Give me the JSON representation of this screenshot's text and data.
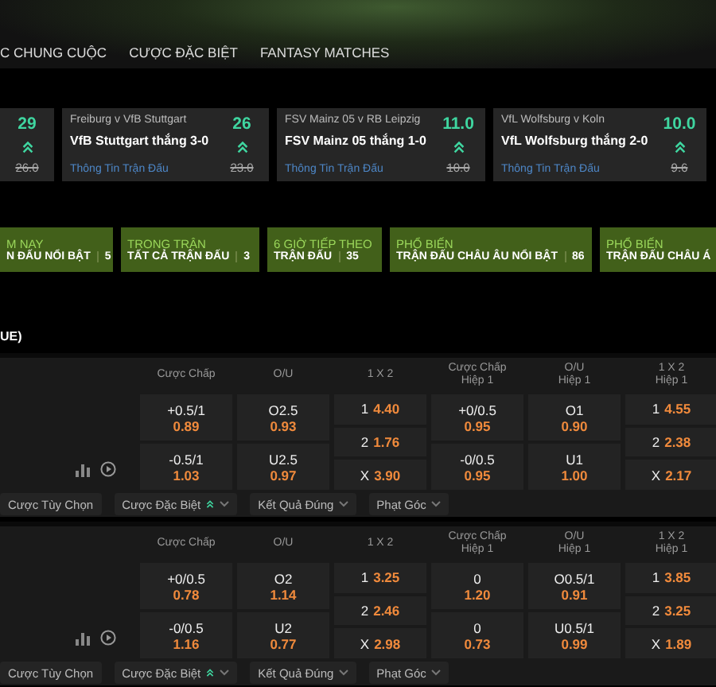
{
  "nav": {
    "tabs": [
      {
        "label": "C CHUNG CUỘC"
      },
      {
        "label": "CƯỢC ĐẶC BIỆT"
      },
      {
        "label": "FANTASY MATCHES"
      }
    ]
  },
  "featured_bets": [
    {
      "odds": "29",
      "old_odds": "26.0"
    },
    {
      "match": "Freiburg v VfB Stuttgart",
      "bet": "VfB Stuttgart thắng 3-0",
      "link": "Thông Tin Trận Đấu",
      "odds": "26",
      "old_odds": "23.0"
    },
    {
      "match": "FSV Mainz 05 v RB Leipzig",
      "bet": "FSV Mainz 05 thắng 1-0",
      "link": "Thông Tin Trận Đấu",
      "odds": "11.0",
      "old_odds": "10.0"
    },
    {
      "match": "VfL Wolfsburg v Koln",
      "bet": "VfL Wolfsburg thắng 2-0",
      "link": "Thông Tin Trận Đấu",
      "odds": "10.0",
      "old_odds": "9.6"
    }
  ],
  "categories": [
    {
      "title": "M NAY",
      "subtitle": "N ĐẤU NỔI BẬT",
      "count": "5"
    },
    {
      "title": "TRONG TRẬN",
      "subtitle": "TẤT CẢ TRẬN ĐẤU",
      "count": "3"
    },
    {
      "title": "6 GIỜ TIẾP THEO",
      "subtitle": "TRẬN ĐẤU",
      "count": "35"
    },
    {
      "title": "PHỔ BIẾN",
      "subtitle": "TRẬN ĐẤU CHÂU ÂU NỔI BẬT",
      "count": "86"
    },
    {
      "title": "PHỔ BIẾN",
      "subtitle": "TRẬN ĐẤU CHÂU Á"
    }
  ],
  "section_title": "UE)",
  "matches": [
    {
      "headers": [
        {
          "label": "Cược Chấp"
        },
        {
          "label": "O/U"
        },
        {
          "label": "1 X 2"
        },
        {
          "label": "Cược Chấp",
          "sub": "Hiệp 1"
        },
        {
          "label": "O/U",
          "sub": "Hiệp 1"
        },
        {
          "label": "1 X 2",
          "sub": "Hiệp 1"
        }
      ],
      "markets": [
        {
          "kind": "pair",
          "cells": [
            {
              "line": "+0.5/1",
              "odds": "0.89"
            },
            {
              "line": "-0.5/1",
              "odds": "1.03"
            }
          ]
        },
        {
          "kind": "pair",
          "cells": [
            {
              "line": "O2.5",
              "odds": "0.93"
            },
            {
              "line": "U2.5",
              "odds": "0.97"
            }
          ]
        },
        {
          "kind": "triple",
          "cells": [
            {
              "line": "1",
              "odds": "4.40"
            },
            {
              "line": "2",
              "odds": "1.76"
            },
            {
              "line": "X",
              "odds": "3.90"
            }
          ]
        },
        {
          "kind": "pair",
          "cells": [
            {
              "line": "+0/0.5",
              "odds": "0.95"
            },
            {
              "line": "-0/0.5",
              "odds": "0.95"
            }
          ]
        },
        {
          "kind": "pair",
          "cells": [
            {
              "line": "O1",
              "odds": "0.90"
            },
            {
              "line": "U1",
              "odds": "1.00"
            }
          ]
        },
        {
          "kind": "triple",
          "cells": [
            {
              "line": "1",
              "odds": "4.55"
            },
            {
              "line": "2",
              "odds": "2.38"
            },
            {
              "line": "X",
              "odds": "2.17"
            }
          ]
        }
      ],
      "options": [
        {
          "label": "Cược Tùy Chọn",
          "kind": "plain"
        },
        {
          "label": "Cược Đặc Biệt",
          "kind": "special"
        },
        {
          "label": "Kết Quả Đúng",
          "kind": "dropdown"
        },
        {
          "label": "Phạt Góc",
          "kind": "dropdown"
        }
      ]
    },
    {
      "headers": [
        {
          "label": "Cược Chấp"
        },
        {
          "label": "O/U"
        },
        {
          "label": "1 X 2"
        },
        {
          "label": "Cược Chấp",
          "sub": "Hiệp 1"
        },
        {
          "label": "O/U",
          "sub": "Hiệp 1"
        },
        {
          "label": "1 X 2",
          "sub": "Hiệp 1"
        }
      ],
      "markets": [
        {
          "kind": "pair",
          "cells": [
            {
              "line": "+0/0.5",
              "odds": "0.78"
            },
            {
              "line": "-0/0.5",
              "odds": "1.16"
            }
          ]
        },
        {
          "kind": "pair",
          "cells": [
            {
              "line": "O2",
              "odds": "1.14"
            },
            {
              "line": "U2",
              "odds": "0.77"
            }
          ]
        },
        {
          "kind": "triple",
          "cells": [
            {
              "line": "1",
              "odds": "3.25"
            },
            {
              "line": "2",
              "odds": "2.46"
            },
            {
              "line": "X",
              "odds": "2.98"
            }
          ]
        },
        {
          "kind": "pair",
          "cells": [
            {
              "line": "0",
              "odds": "1.20"
            },
            {
              "line": "0",
              "odds": "0.73"
            }
          ]
        },
        {
          "kind": "pair",
          "cells": [
            {
              "line": "O0.5/1",
              "odds": "0.91"
            },
            {
              "line": "U0.5/1",
              "odds": "0.99"
            }
          ]
        },
        {
          "kind": "triple",
          "cells": [
            {
              "line": "1",
              "odds": "3.85"
            },
            {
              "line": "2",
              "odds": "3.25"
            },
            {
              "line": "X",
              "odds": "1.89"
            }
          ]
        }
      ],
      "options": [
        {
          "label": "Cược Tùy Chọn",
          "kind": "plain"
        },
        {
          "label": "Cược Đặc Biệt",
          "kind": "special"
        },
        {
          "label": "Kết Quả Đúng",
          "kind": "dropdown"
        },
        {
          "label": "Phạt Góc",
          "kind": "dropdown"
        }
      ]
    }
  ]
}
